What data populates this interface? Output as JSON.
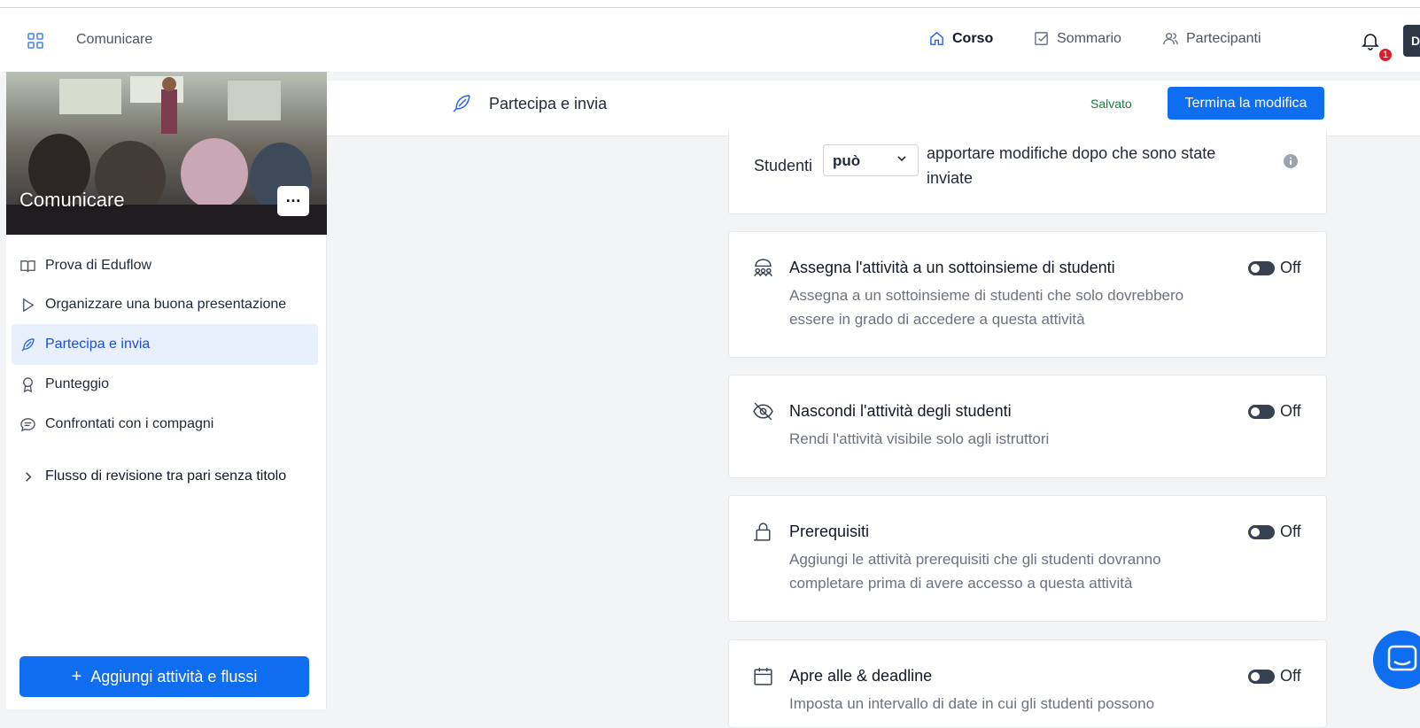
{
  "topbar": {
    "app_name": "Comunicare",
    "nav": [
      {
        "label": "Corso",
        "icon": "home-icon"
      },
      {
        "label": "Sommario",
        "icon": "checkbox-icon"
      },
      {
        "label": "Partecipanti",
        "icon": "users-icon"
      }
    ],
    "notifications": "1",
    "avatar_letter": "D"
  },
  "sidebar": {
    "course_title": "Comunicare",
    "more_label": "…",
    "items": [
      {
        "label": "Prova di Eduflow",
        "icon": "book-icon"
      },
      {
        "label": "Organizzare una buona presentazione",
        "icon": "play-icon"
      },
      {
        "label": "Partecipa e invia",
        "icon": "feather-icon"
      },
      {
        "label": "Punteggio",
        "icon": "award-icon"
      },
      {
        "label": "Confrontati con i compagni",
        "icon": "chat-icon"
      }
    ],
    "flow": "Flusso di revisione tra pari senza titolo",
    "add_button": "Aggiungi attività e flussi"
  },
  "header": {
    "title": "Partecipa e invia",
    "status": "Salvato",
    "finish_button": "Termina la modifica"
  },
  "students_setting": {
    "label": "Studenti",
    "selected": "può",
    "rest": "apportare modifiche dopo che sono state inviate"
  },
  "settings": [
    {
      "icon": "group-icon",
      "title": "Assegna l'attività a un sottoinsieme di studenti",
      "description": "Assegna a un sottoinsieme di studenti che solo dovrebbero essere in grado di accedere a questa attività",
      "toggle": "Off"
    },
    {
      "icon": "eye-off-icon",
      "title": "Nascondi l'attività degli studenti",
      "description": "Rendi l'attività visibile solo agli istruttori",
      "toggle": "Off"
    },
    {
      "icon": "lock-icon",
      "title": "Prerequisiti",
      "description": "Aggiungi le attività prerequisiti che gli studenti dovranno completare prima di avere accesso a questa attività",
      "toggle": "Off"
    },
    {
      "icon": "calendar-icon",
      "title": "Apre alle & deadline",
      "description": "Imposta un intervallo di date in cui gli studenti possono",
      "toggle": "Off"
    }
  ]
}
